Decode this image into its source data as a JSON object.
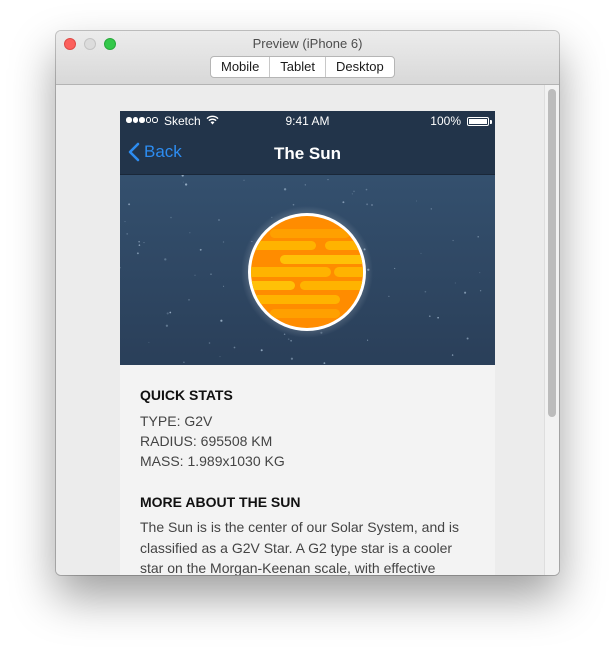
{
  "window": {
    "title": "Preview (iPhone 6)",
    "segments": [
      "Mobile",
      "Tablet",
      "Desktop"
    ]
  },
  "status_bar": {
    "carrier": "Sketch",
    "time": "9:41 AM",
    "battery": "100%"
  },
  "nav": {
    "back_label": "Back",
    "title": "The Sun"
  },
  "quick_stats": {
    "heading": "QUICK STATS",
    "items": [
      "TYPE: G2V",
      "RADIUS: 695508 KM",
      "MASS: 1.989x1030 KG"
    ]
  },
  "about": {
    "heading": "MORE ABOUT THE SUN",
    "text": "The Sun is is the center of our Solar System, and is classified as a G2V Star. A G2 type star is a cooler star on the Morgan-Keenan scale, with effective"
  },
  "colors": {
    "nav_bg": "#22344a",
    "accent": "#2d8cf0",
    "sun_orange": "#ff8c00",
    "sun_yellow": "#ffb300"
  }
}
